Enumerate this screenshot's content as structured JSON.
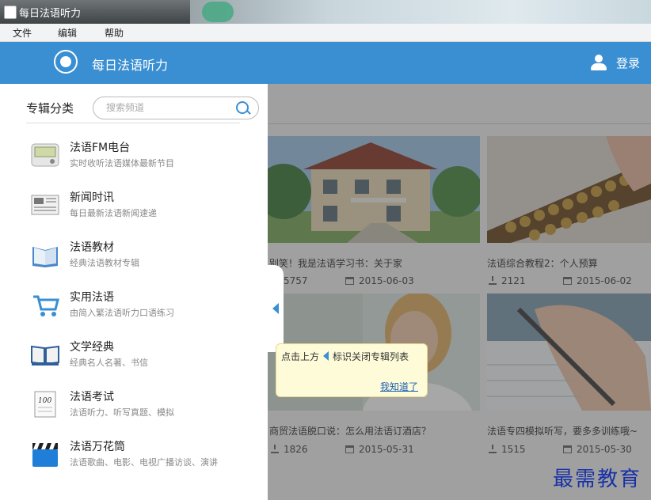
{
  "window": {
    "title": "每日法语听力"
  },
  "menu": [
    "文件",
    "编辑",
    "帮助"
  ],
  "header": {
    "app_name": "每日法语听力",
    "login_label": "登录"
  },
  "sidebar": {
    "heading": "专辑分类",
    "search_placeholder": "搜索频道",
    "items": [
      {
        "title": "法语FM电台",
        "subtitle": "实时收听法语媒体最新节目",
        "icon": "radio-icon"
      },
      {
        "title": "新闻时讯",
        "subtitle": "每日最新法语新闻速递",
        "icon": "newspaper-icon"
      },
      {
        "title": "法语教材",
        "subtitle": "经典法语教材专辑",
        "icon": "textbook-icon"
      },
      {
        "title": "实用法语",
        "subtitle": "由简入繁法语听力口语练习",
        "icon": "shopping-cart-icon"
      },
      {
        "title": "文学经典",
        "subtitle": "经典名人名著、书信",
        "icon": "open-book-icon"
      },
      {
        "title": "法语考试",
        "subtitle": "法语听力、听写真题、模拟",
        "icon": "exam-paper-icon"
      },
      {
        "title": "法语万花筒",
        "subtitle": "法语歌曲、电影、电视广播访谈、演讲",
        "icon": "clapperboard-icon"
      }
    ]
  },
  "cards": [
    {
      "title": "别笑！我是法语学习书：关于家",
      "downloads": "5757",
      "date": "2015-06-03",
      "image": "house-photo"
    },
    {
      "title": "法语综合教程2：个人预算",
      "downloads": "2121",
      "date": "2015-06-02",
      "image": "abacus-photo"
    },
    {
      "title": "商贸法语脱口说：怎么用法语订酒店？",
      "downloads": "1826",
      "date": "2015-05-31",
      "image": "smiling-woman-photo"
    },
    {
      "title": "法语专四模拟听写，要多多训练哦~",
      "downloads": "1515",
      "date": "2015-05-30",
      "image": "writing-hand-photo"
    }
  ],
  "tooltip": {
    "text_before": "点击上方",
    "text_after": "标识关闭专辑列表",
    "confirm": "我知道了"
  },
  "watermark": "最需教育",
  "colors": {
    "accent": "#3a8fd2",
    "tooltip_bg": "#fefbd8",
    "watermark": "#1730a8"
  }
}
